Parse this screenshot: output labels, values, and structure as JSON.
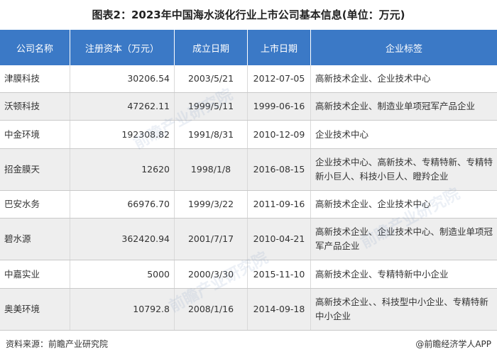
{
  "title": "图表2：2023年中国海水淡化行业上市公司基本信息(单位：万元)",
  "table": {
    "headers": [
      "公司名称",
      "注册资本（万元）",
      "成立日期",
      "上市日期",
      "企业标签"
    ],
    "rows": [
      {
        "name": "津膜科技",
        "capital": "30206.54",
        "founded": "2003/5/21",
        "listed": "2012-07-05",
        "tags": "高新技术企业、企业技术中心"
      },
      {
        "name": "沃顿科技",
        "capital": "47262.11",
        "founded": "1999/5/11",
        "listed": "1999-06-16",
        "tags": "高新技术企业、制造业单项冠军产品企业"
      },
      {
        "name": "中金环境",
        "capital": "192308.82",
        "founded": "1991/8/31",
        "listed": "2010-12-09",
        "tags": "企业技术中心"
      },
      {
        "name": "招金膜天",
        "capital": "12620",
        "founded": "1998/1/8",
        "listed": "2016-08-15",
        "tags": "企业技术中心、高新技术、专精特新、专精特新小巨人、科技小巨人、瞪羚企业"
      },
      {
        "name": "巴安水务",
        "capital": "66976.70",
        "founded": "1999/3/22",
        "listed": "2011-09-16",
        "tags": "高新技术企业、企业技术中心"
      },
      {
        "name": "碧水源",
        "capital": "362420.94",
        "founded": "2001/7/17",
        "listed": "2010-04-21",
        "tags": "高新技术企业、企业技术中心、制造业单项冠军产品企业"
      },
      {
        "name": "中嘉实业",
        "capital": "5000",
        "founded": "2000/3/30",
        "listed": "2015-11-10",
        "tags": "高新技术企业、专精特新中小企业"
      },
      {
        "name": "奥美环境",
        "capital": "10792.8",
        "founded": "2008/1/16",
        "listed": "2014-09-18",
        "tags": "高新技术企业、、科技型中小企业、专精特新中小企业"
      }
    ]
  },
  "footer": {
    "source": "资料来源：前瞻产业研究院",
    "brand": "@前瞻经济学人APP"
  },
  "watermark": "前瞻产业研究院"
}
